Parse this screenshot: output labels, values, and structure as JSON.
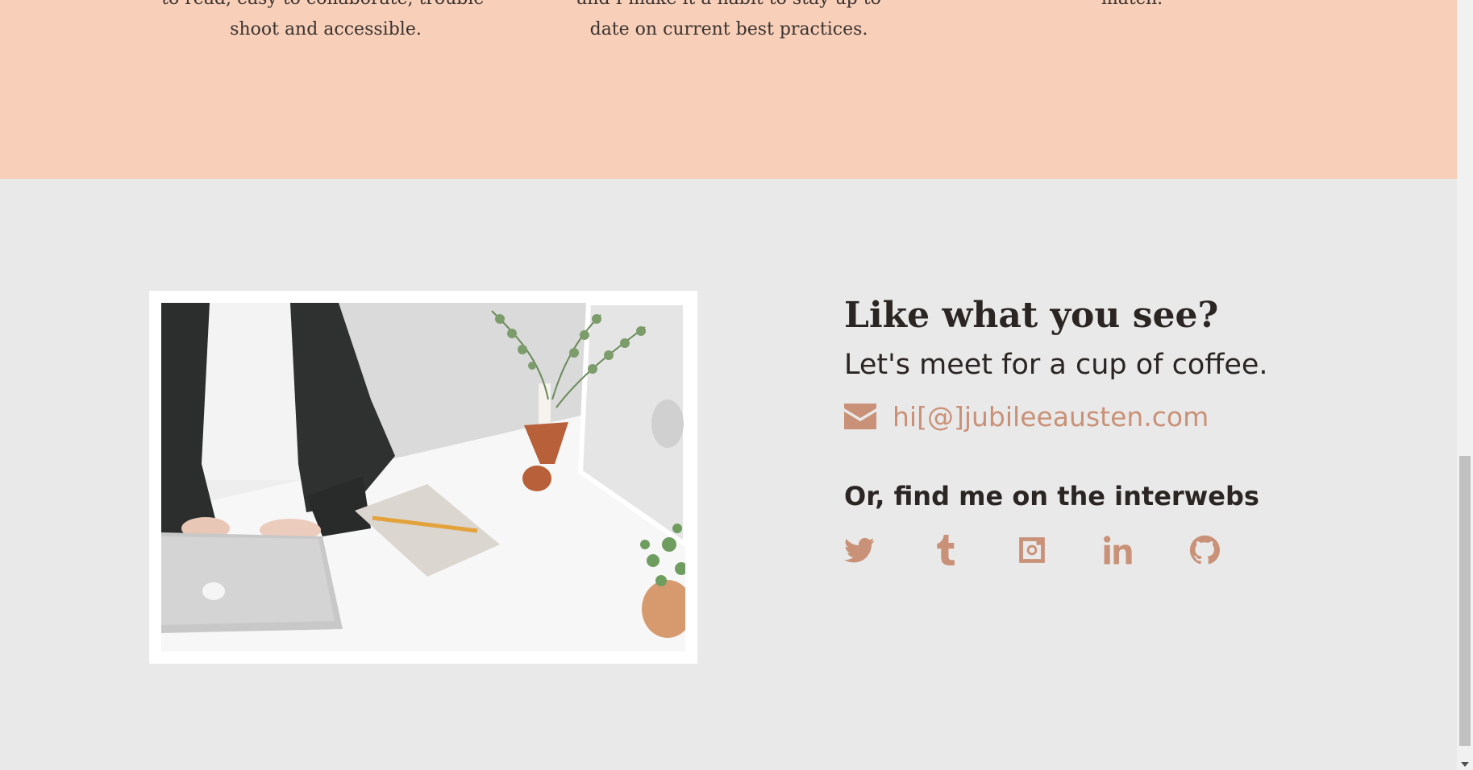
{
  "features": [
    {
      "text": "to read, easy to collaborate, trouble-\nshoot and accessible."
    },
    {
      "text": "and I make it a habit to stay up to\ndate on current best practices."
    },
    {
      "text": "match."
    }
  ],
  "contact": {
    "title": "Like what you see?",
    "subtitle": "Let's meet for a cup of coffee.",
    "email": "hi[@]jubileeausten.com",
    "interwebs_heading": "Or, find me on the interwebs",
    "socials": [
      {
        "icon": "twitter-icon"
      },
      {
        "icon": "tumblr-icon"
      },
      {
        "icon": "instagram-icon"
      },
      {
        "icon": "linkedin-icon"
      },
      {
        "icon": "github-icon"
      }
    ],
    "accent_color": "#c99177",
    "photo_alt": "Woman at desk with laptop"
  },
  "colors": {
    "features_bg": "#f8cfb8",
    "contact_bg": "#e9e9e9",
    "text": "#2b2624"
  }
}
